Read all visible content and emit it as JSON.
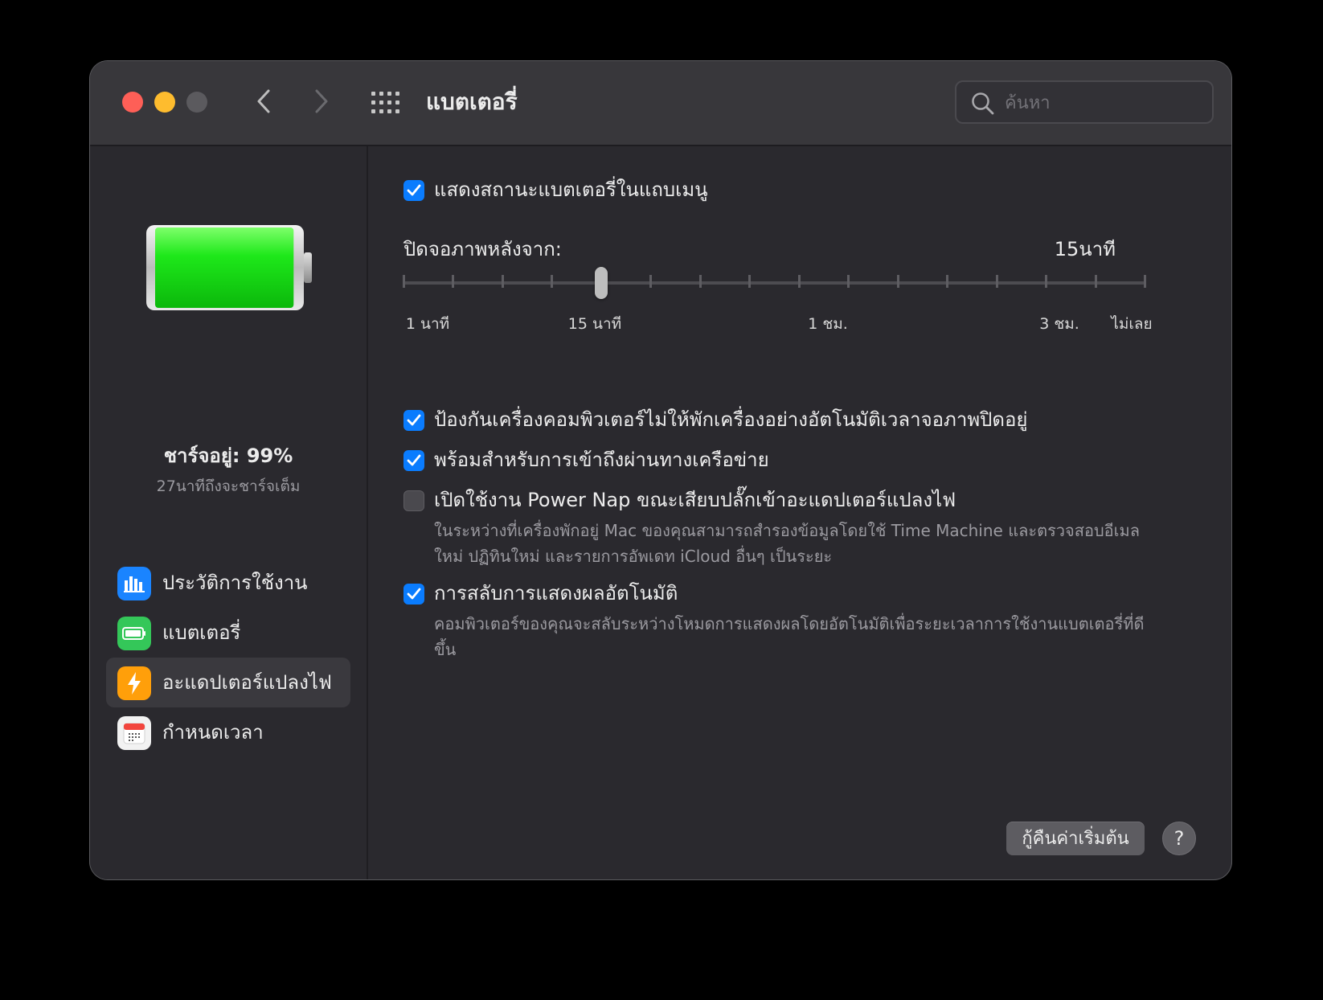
{
  "window": {
    "title": "แบตเตอรี่",
    "search_placeholder": "ค้นหา"
  },
  "sidebar": {
    "charge_title": "ชาร์จอยู่: 99%",
    "charge_subtitle": "27นาทีถึงจะชาร์จเต็ม",
    "battery_level": 0.99,
    "items": [
      {
        "label": "ประวัติการใช้งาน",
        "icon": "bar-chart-icon",
        "color": "#1a84ff"
      },
      {
        "label": "แบตเตอรี่",
        "icon": "battery-icon",
        "color": "#34c759"
      },
      {
        "label": "อะแดปเตอร์แปลงไฟ",
        "icon": "lightning-icon",
        "color": "#ff9f0a",
        "active": true
      },
      {
        "label": "กำหนดเวลา",
        "icon": "calendar-icon",
        "color": "#ffffff"
      }
    ]
  },
  "main": {
    "show_status": {
      "label": "แสดงสถานะแบตเตอรี่ในแถบเมนู",
      "checked": true
    },
    "display_off": {
      "label": "ปิดจอภาพหลังจาก:",
      "value": "15นาที",
      "tick_count": 16,
      "selected_index": 4,
      "tick_labels": {
        "one_min": "1 นาที",
        "fifteen_min": "15 นาที",
        "one_hour": "1 ชม.",
        "three_hours": "3 ชม.",
        "never": "ไม่เลย"
      }
    },
    "prevent_sleep": {
      "label": "ป้องกันเครื่องคอมพิวเตอร์ไม่ให้พักเครื่องอย่างอัตโนมัติเวลาจอภาพปิดอยู่",
      "checked": true
    },
    "network_access": {
      "label": "พร้อมสำหรับการเข้าถึงผ่านทางเครือข่าย",
      "checked": true
    },
    "power_nap": {
      "label": "เปิดใช้งาน Power Nap ขณะเสียบปลั๊กเข้าอะแดปเตอร์แปลงไฟ",
      "checked": false,
      "description": "ในระหว่างที่เครื่องพักอยู่ Mac ของคุณสามารถสำรองข้อมูลโดยใช้ Time Machine และตรวจสอบอีเมลใหม่ ปฏิทินใหม่ และรายการอัพเดท iCloud อื่นๆ เป็นระยะ"
    },
    "auto_graphics": {
      "label": "การสลับการแสดงผลอัตโนมัติ",
      "checked": true,
      "description": "คอมพิวเตอร์ของคุณจะสลับระหว่างโหมดการแสดงผลโดยอัตโนมัติเพื่อระยะเวลาการใช้งานแบตเตอรี่ที่ดีขึ้น"
    },
    "restore_defaults": "กู้คืนค่าเริ่มต้น",
    "help": "?"
  }
}
